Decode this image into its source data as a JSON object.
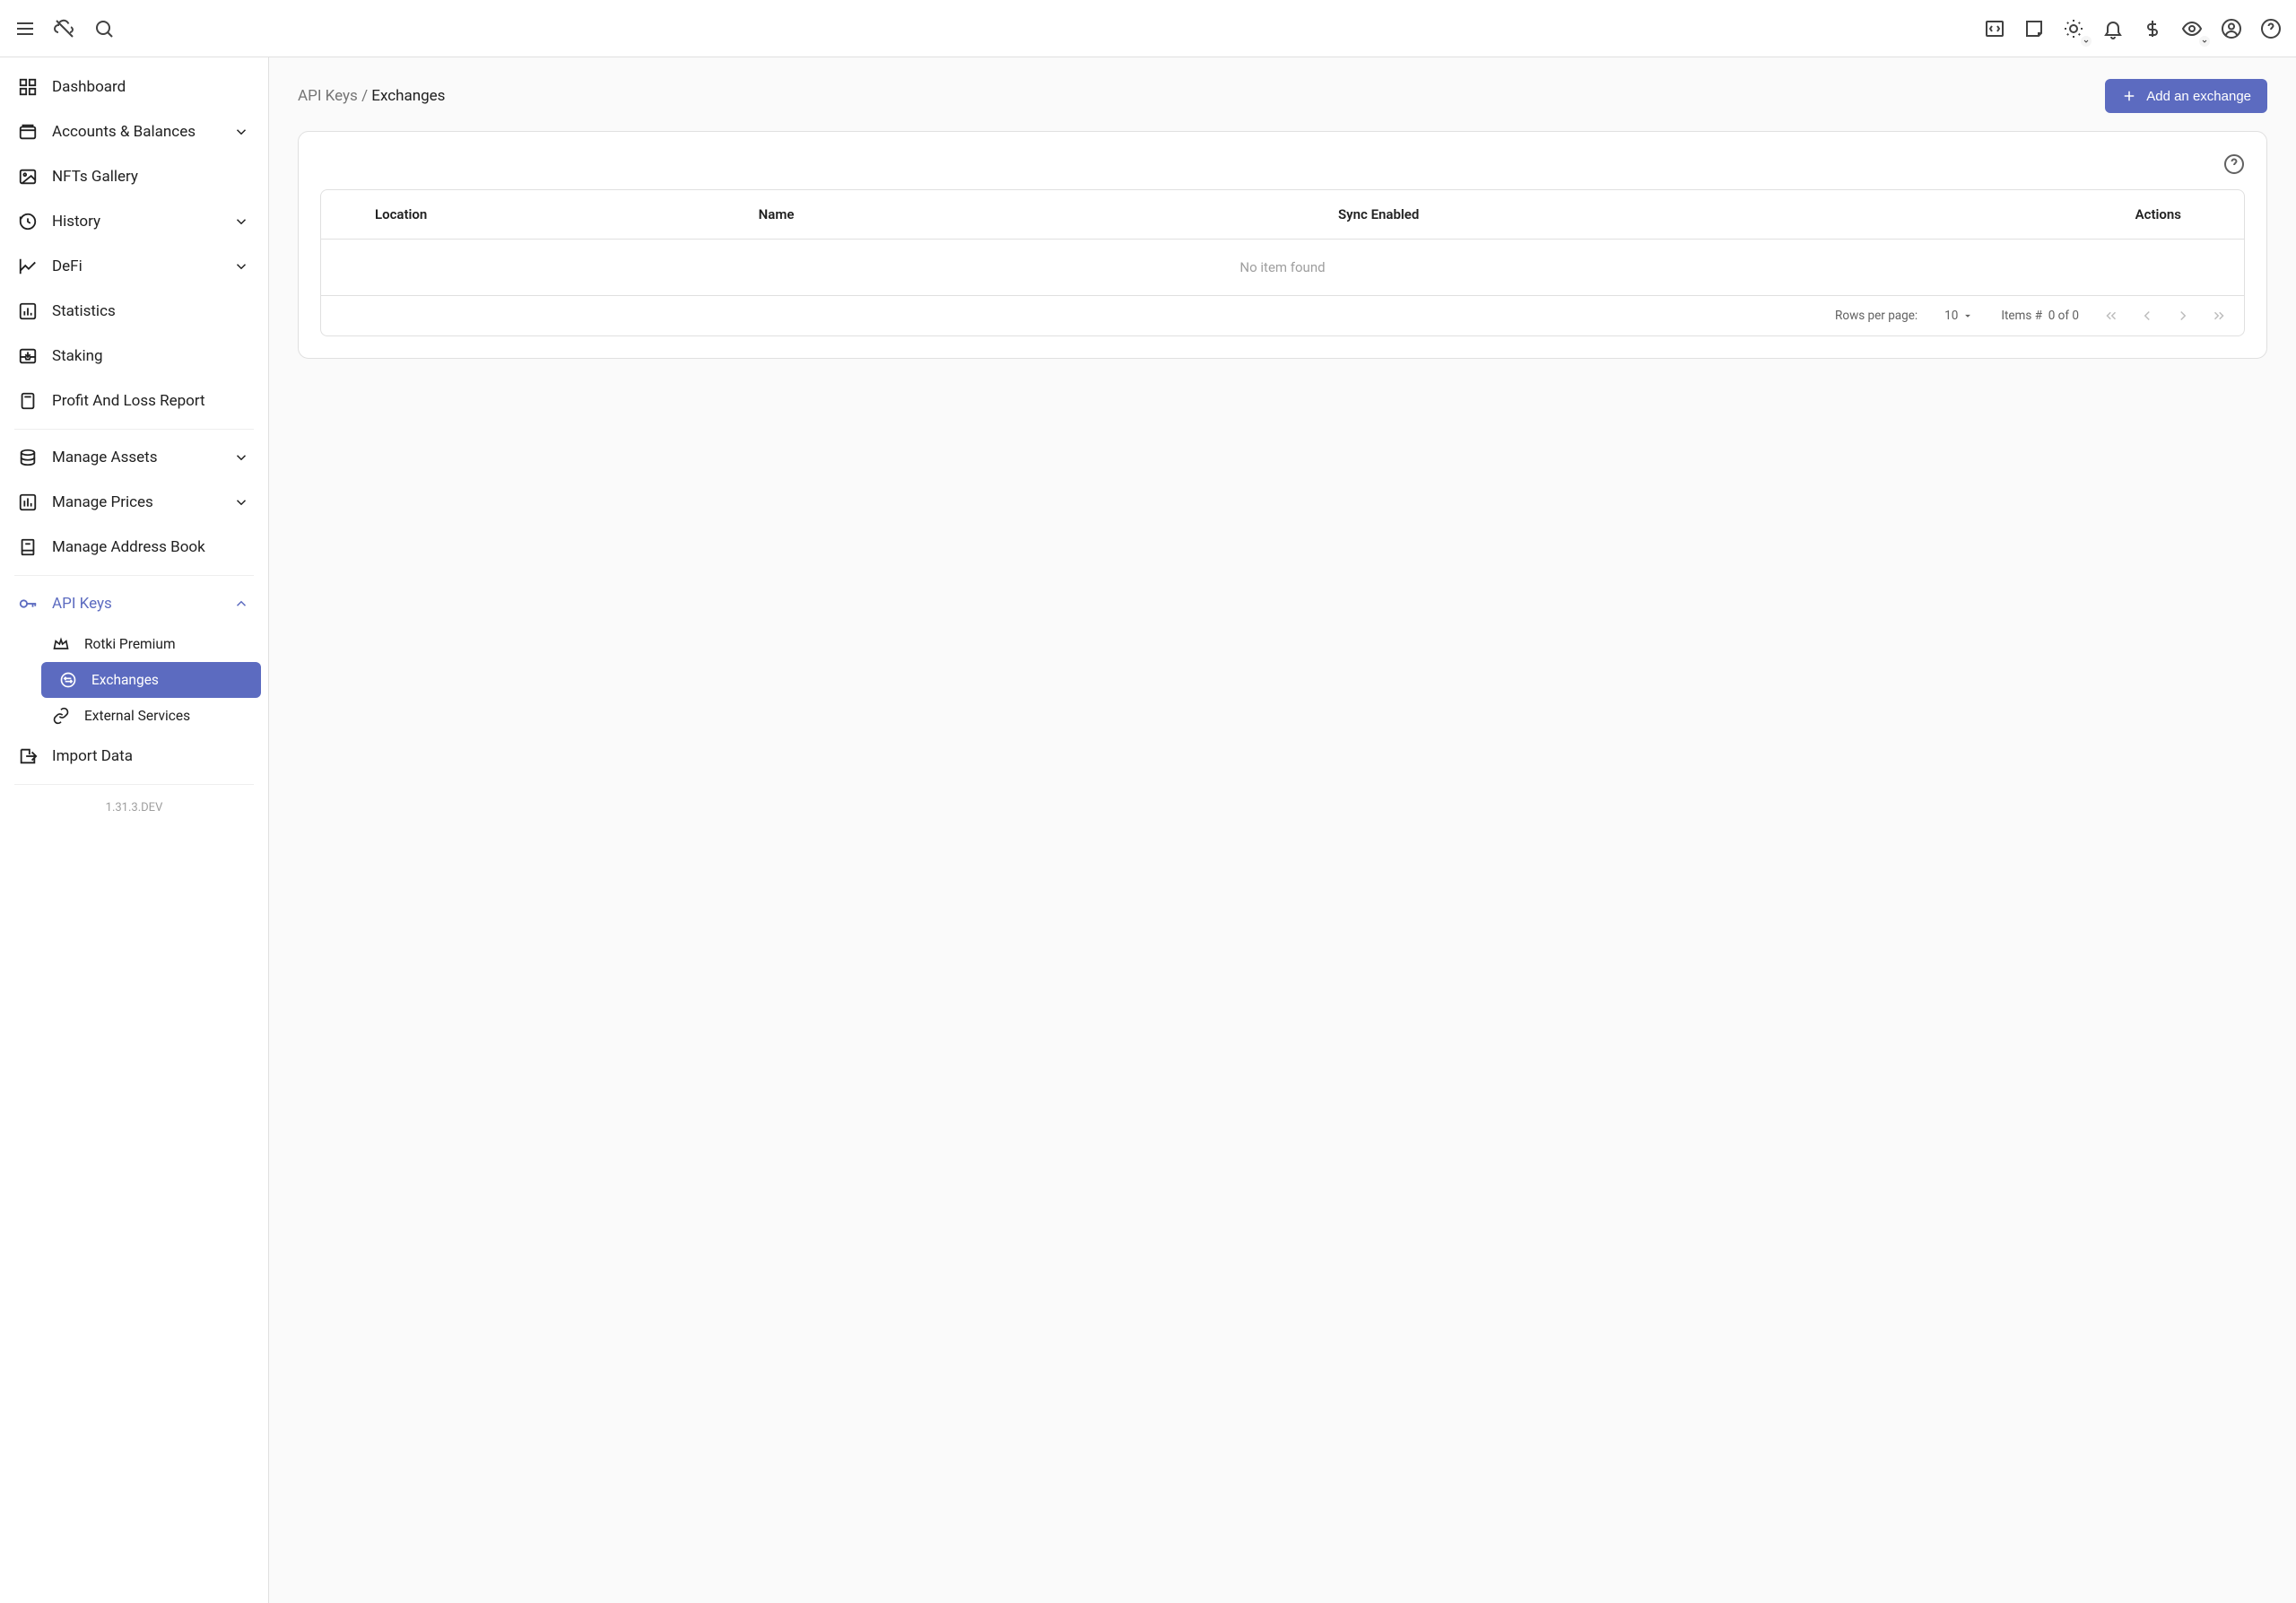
{
  "topbar": {},
  "sidebar": {
    "items": [
      {
        "label": "Dashboard",
        "expandable": false
      },
      {
        "label": "Accounts & Balances",
        "expandable": true
      },
      {
        "label": "NFTs Gallery",
        "expandable": false
      },
      {
        "label": "History",
        "expandable": true
      },
      {
        "label": "DeFi",
        "expandable": true
      },
      {
        "label": "Statistics",
        "expandable": false
      },
      {
        "label": "Staking",
        "expandable": false
      },
      {
        "label": "Profit And Loss Report",
        "expandable": false
      }
    ],
    "manage": [
      {
        "label": "Manage Assets",
        "expandable": true
      },
      {
        "label": "Manage Prices",
        "expandable": true
      },
      {
        "label": "Manage Address Book",
        "expandable": false
      }
    ],
    "api_keys": {
      "label": "API Keys",
      "children": [
        {
          "label": "Rotki Premium",
          "active": false
        },
        {
          "label": "Exchanges",
          "active": true
        },
        {
          "label": "External Services",
          "active": false
        }
      ]
    },
    "import_data_label": "Import Data",
    "version": "1.31.3.DEV"
  },
  "breadcrumb": {
    "parent": "API Keys",
    "sep": "/",
    "current": "Exchanges"
  },
  "actions": {
    "add_exchange": "Add an exchange"
  },
  "table": {
    "columns": {
      "location": "Location",
      "name": "Name",
      "sync": "Sync Enabled",
      "actions": "Actions"
    },
    "empty": "No item found",
    "footer": {
      "rows_label": "Rows per page:",
      "rows_value": "10",
      "items_label": "Items #",
      "items_value": "0 of 0"
    }
  }
}
